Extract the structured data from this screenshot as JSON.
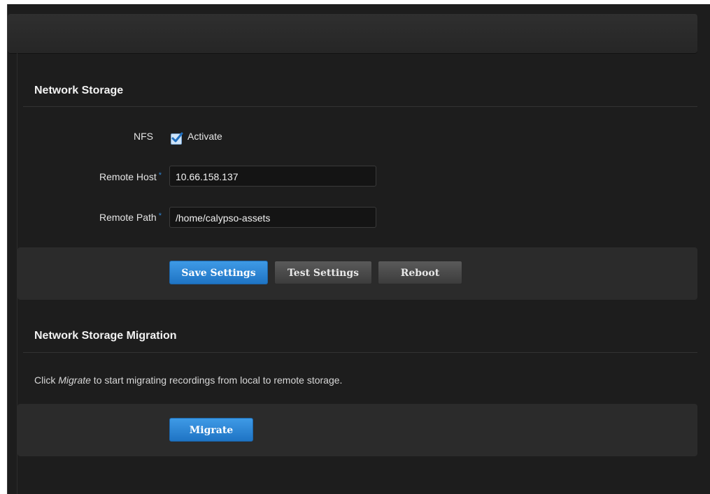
{
  "network_storage": {
    "title": "Network Storage",
    "nfs_label": "NFS",
    "activate_label": "Activate",
    "activate_checked": true,
    "remote_host_label": "Remote Host",
    "remote_host_value": "10.66.158.137",
    "remote_path_label": "Remote Path",
    "remote_path_value": "/home/calypso-assets",
    "required_marker": "*",
    "buttons": {
      "save": "Save Settings",
      "test": "Test Settings",
      "reboot": "Reboot"
    }
  },
  "migration": {
    "title": "Network Storage Migration",
    "desc_prefix": "Click ",
    "desc_emphasis": "Migrate",
    "desc_suffix": " to start migrating recordings from local to remote storage.",
    "migrate_button": "Migrate"
  },
  "colors": {
    "accent": "#2f86d6",
    "background": "#1d1d1d",
    "panel": "#2b2b2b"
  }
}
